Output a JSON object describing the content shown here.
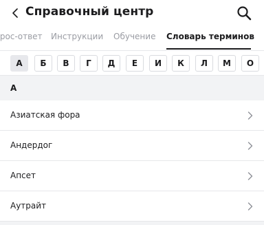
{
  "header": {
    "back_icon": "chevron-left-icon",
    "title": "Справочный центр",
    "search_icon": "search-icon"
  },
  "tabs": [
    {
      "label": "прос-ответ",
      "active": false
    },
    {
      "label": "Инструкции",
      "active": false
    },
    {
      "label": "Обучение",
      "active": false
    },
    {
      "label": "Словарь терминов",
      "active": true
    }
  ],
  "letters": [
    "А",
    "Б",
    "В",
    "Г",
    "Д",
    "Е",
    "И",
    "К",
    "Л",
    "М",
    "О"
  ],
  "active_letter": "А",
  "section": {
    "letter": "А",
    "items": [
      {
        "label": "Азиатская фора"
      },
      {
        "label": "Андердог"
      },
      {
        "label": "Апсет"
      },
      {
        "label": "Аутрайт"
      }
    ]
  },
  "colors": {
    "background": "#f2f3f5",
    "text": "#1c1c1e",
    "inactive_tab": "#9a9ca3",
    "active_letter_bg": "#e7e8ec"
  }
}
